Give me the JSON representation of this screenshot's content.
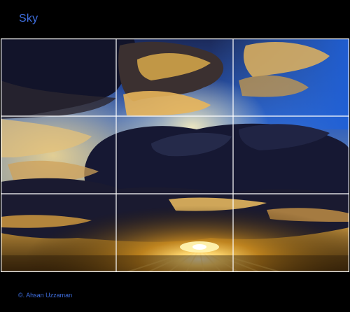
{
  "header": {
    "title": "Sky"
  },
  "photo": {
    "subject": "sunset-sky-with-clouds",
    "grid_rows": 3,
    "grid_cols": 3
  },
  "footer": {
    "credit": "©. Ahsan Uzzaman"
  },
  "colors": {
    "background": "#000000",
    "text_accent": "#3f6fe0",
    "grid_line": "#ffffff",
    "sky_blue": "#2d6fd8",
    "sun_gold": "#ffd870",
    "cloud_dark": "#181a33"
  }
}
